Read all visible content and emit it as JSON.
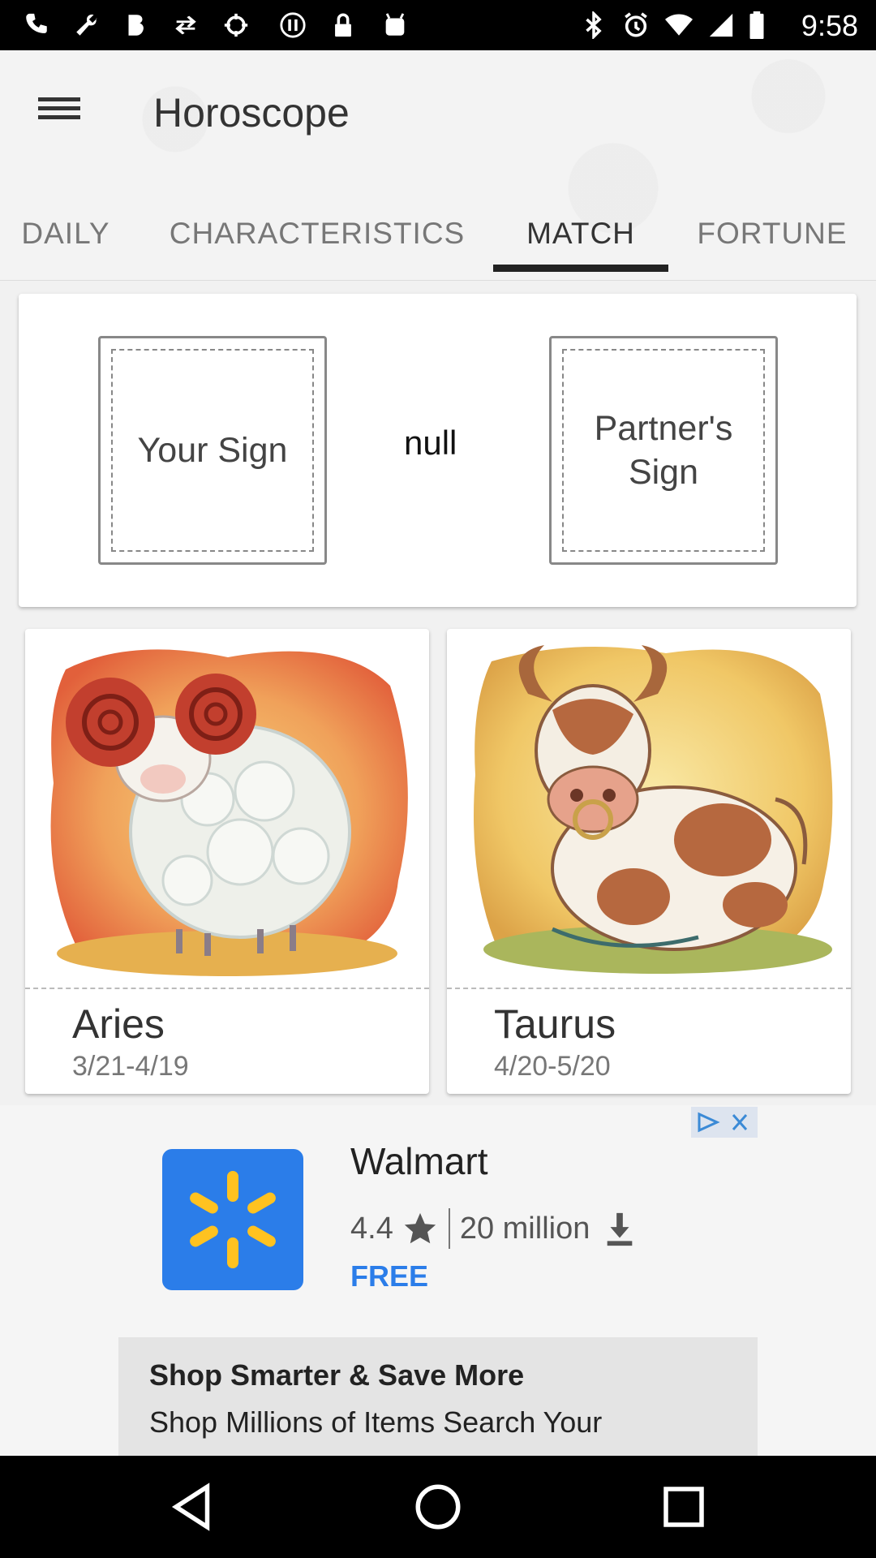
{
  "status_bar": {
    "time": "9:58",
    "left_icons": [
      "phone-icon",
      "wrench-icon",
      "bold-b-icon",
      "swap-icon",
      "fake-gps-icon",
      "alert-icon",
      "lock-icon",
      "android-icon"
    ],
    "right_icons": [
      "bluetooth-icon",
      "alarm-icon",
      "wifi-icon",
      "signal-icon",
      "battery-icon"
    ]
  },
  "header": {
    "title": "Horoscope",
    "tabs": [
      {
        "label": "DAILY",
        "active": false
      },
      {
        "label": "CHARACTERISTICS",
        "active": false
      },
      {
        "label": "MATCH",
        "active": true
      },
      {
        "label": "FORTUNE",
        "active": false
      }
    ]
  },
  "match": {
    "your_sign": "Your Sign",
    "result": "null",
    "partner_sign": "Partner's Sign"
  },
  "zodiac": [
    {
      "name": "Aries",
      "dates": "3/21-4/19",
      "art": "ram-illustration"
    },
    {
      "name": "Taurus",
      "dates": "4/20-5/20",
      "art": "bull-illustration"
    }
  ],
  "ad": {
    "app_name": "Walmart",
    "rating": "4.4",
    "downloads": "20 million",
    "price": "FREE",
    "headline": "Shop Smarter & Save More",
    "body": "Shop Millions of Items Search Your",
    "accent": "#2b7de9"
  },
  "navbar": {
    "buttons": [
      "back-icon",
      "home-icon",
      "recents-icon"
    ]
  }
}
